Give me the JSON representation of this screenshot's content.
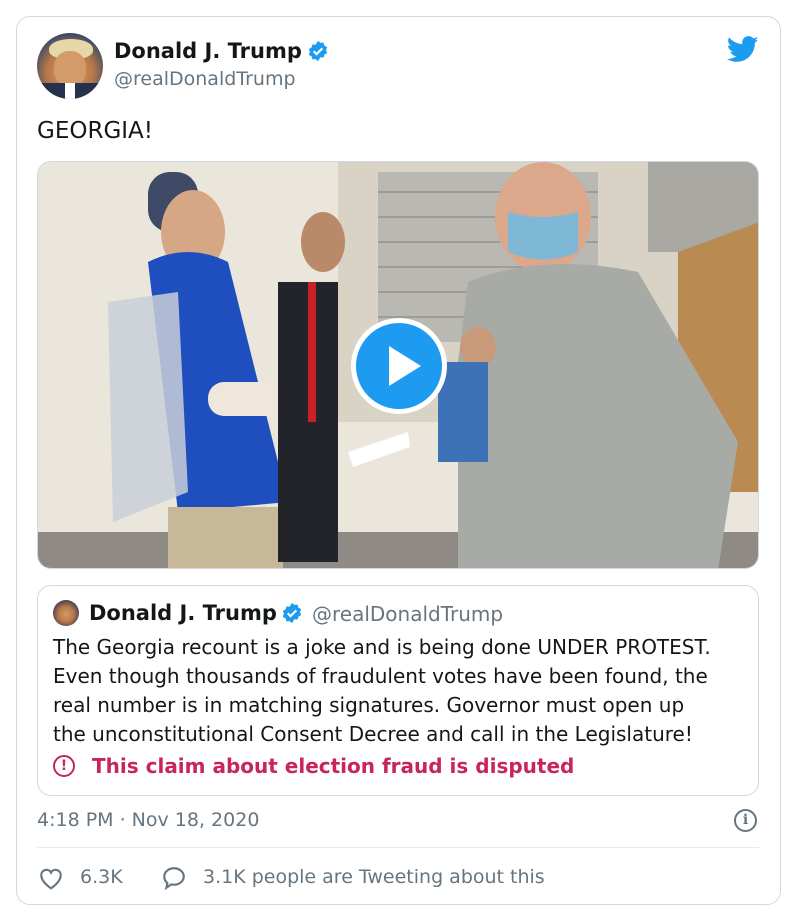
{
  "tweet": {
    "author_name": "Donald J. Trump",
    "author_handle": "@realDonaldTrump",
    "text": "GEORGIA!",
    "timestamp": "4:18 PM · Nov 18, 2020",
    "likes": "6.3K",
    "talking": "3.1K people are Tweeting about this"
  },
  "quoted_tweet": {
    "author_name": "Donald J. Trump",
    "author_handle": "@realDonaldTrump",
    "text": "The Georgia recount is a joke and is being done UNDER PROTEST.\nEven though thousands of fraudulent votes have been found, the\nreal number is in matching signatures. Governor must open up\nthe unconstitutional Consent Decree and call in the Legislature!",
    "label": "This claim about election fraud is disputed"
  },
  "icons": {
    "brand": "twitter-bird-icon",
    "verified": "verified-badge-icon",
    "play": "play-icon",
    "warning": "exclamation-circle-icon",
    "info": "info-icon",
    "like": "heart-icon",
    "reply": "speech-bubble-icon"
  },
  "colors": {
    "brand_blue": "#1d9bf0",
    "disputed_red": "#c8245e",
    "muted_text": "#66757f",
    "border": "#cfd9de"
  }
}
